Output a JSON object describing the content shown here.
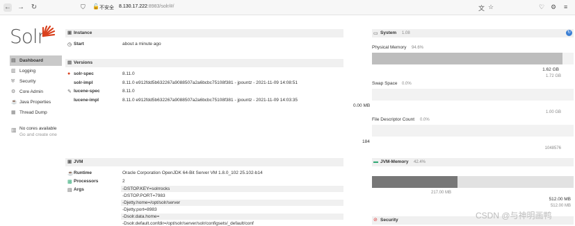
{
  "browser": {
    "security_label": "不安全",
    "url_host": "8.130.17.222",
    "url_rest": ":8983/solr/#/"
  },
  "logo": {
    "text": "Solr"
  },
  "sidebar": {
    "items": [
      {
        "label": "Dashboard",
        "icon": "dashboard-icon"
      },
      {
        "label": "Logging",
        "icon": "logging-icon"
      },
      {
        "label": "Security",
        "icon": "security-icon"
      },
      {
        "label": "Core Admin",
        "icon": "core-admin-icon"
      },
      {
        "label": "Java Properties",
        "icon": "java-properties-icon"
      },
      {
        "label": "Thread Dump",
        "icon": "thread-dump-icon"
      }
    ],
    "cores_title": "No cores available",
    "cores_sub": "Go and create one"
  },
  "instance": {
    "title": "Instance",
    "start_label": "Start",
    "start_value": "about a minute ago"
  },
  "versions": {
    "title": "Versions",
    "rows": [
      {
        "label": "solr-spec",
        "value": "8.11.0"
      },
      {
        "label": "solr-impl",
        "value": "8.11.0 e912fdd5b632267a9088507a2a6bcbc75108f381 - jpountz - 2021-11-09 14:08:51"
      },
      {
        "label": "lucene-spec",
        "value": "8.11.0"
      },
      {
        "label": "lucene-impl",
        "value": "8.11.0 e912fdd5b632267a9088507a2a6bcbc75108f381 - jpountz - 2021-11-09 14:03:35"
      }
    ]
  },
  "jvm": {
    "title": "JVM",
    "runtime_label": "Runtime",
    "runtime_value": "Oracle Corporation OpenJDK 64-Bit Server VM 1.8.0_102 25.102-b14",
    "processors_label": "Processors",
    "processors_value": "2",
    "args_label": "Args",
    "args": [
      "-DSTOP.KEY=solrrocks",
      "-DSTOP.PORT=7983",
      "-Djetty.home=/opt/solr/server",
      "-Djetty.port=8983",
      "-Dsolr.data.home=",
      "-Dsolr.default.confdir=/opt/solr/server/solr/configsets/_default/conf"
    ]
  },
  "system": {
    "title": "System",
    "load": "1.08",
    "physical_memory": {
      "label": "Physical Memory",
      "percent": "94.6%",
      "used": "1.62 GB",
      "total": "1.72 GB",
      "fill": 0.946
    },
    "swap_space": {
      "label": "Swap Space",
      "percent": "0.0%",
      "used": "0.00 MB",
      "total": "1.00 GB",
      "fill": 0.0
    },
    "file_descriptor": {
      "label": "File Descriptor Count",
      "percent": "0.0%",
      "used": "184",
      "total": "1048576",
      "fill": 0.0
    }
  },
  "jvm_memory": {
    "title": "JVM-Memory",
    "percent": "42.4%",
    "used": "217.00 MB",
    "max1": "512.00 MB",
    "max2": "512.00 MB",
    "used_fill": 0.424
  },
  "security": {
    "title": "Security"
  },
  "watermark": "CSDN @与神明画鸭"
}
